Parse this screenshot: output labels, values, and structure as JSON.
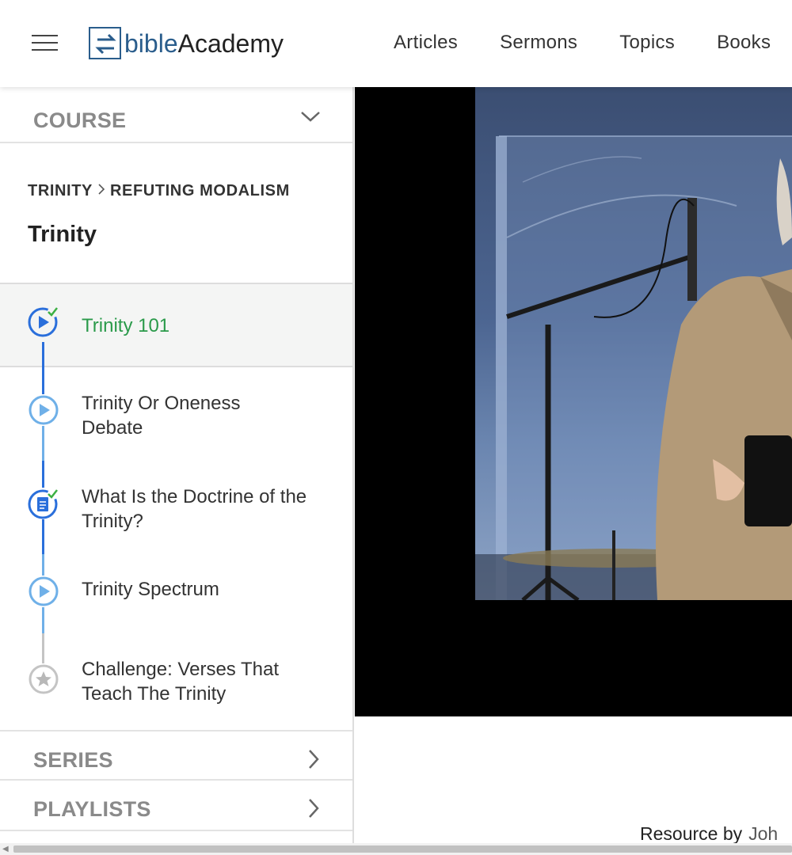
{
  "header": {
    "logo_part1": "bible",
    "logo_part2": "Academy",
    "nav": [
      "Articles",
      "Sermons",
      "Topics",
      "Books"
    ]
  },
  "sidebar": {
    "course_label": "COURSE",
    "breadcrumb": [
      "TRINITY",
      "REFUTING MODALISM"
    ],
    "course_title": "Trinity",
    "lessons": [
      {
        "title": "Trinity 101",
        "type": "video",
        "completed": true,
        "active": true
      },
      {
        "title": "Trinity Or Oneness Debate",
        "type": "video",
        "completed": false,
        "active": false
      },
      {
        "title": "What Is the Doctrine of the Trinity?",
        "type": "article",
        "completed": true,
        "active": false
      },
      {
        "title": "Trinity Spectrum",
        "type": "video",
        "completed": false,
        "active": false
      },
      {
        "title": "Challenge: Verses That Teach The Trinity",
        "type": "challenge",
        "completed": false,
        "active": false
      }
    ],
    "series_label": "SERIES",
    "playlists_label": "PLAYLISTS"
  },
  "main": {
    "resource_label": "Resource by",
    "resource_author": "Joh"
  },
  "colors": {
    "brand": "#2a5d8c",
    "active_green": "#2a9a4a",
    "icon_blue": "#2a6fdb",
    "icon_light_blue": "#6fb0e8",
    "check_green": "#3cb043"
  }
}
